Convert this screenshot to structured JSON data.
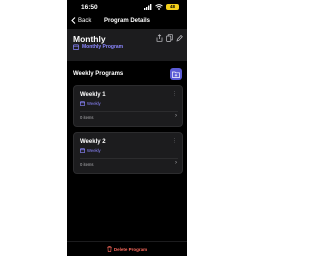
{
  "status_bar": {
    "time": "16:50",
    "battery": "48"
  },
  "nav": {
    "back_label": "Back",
    "title": "Program Details"
  },
  "program": {
    "title": "Monthly",
    "type": "Monthly Program"
  },
  "section": {
    "title": "Weekly Programs"
  },
  "cards": [
    {
      "title": "Weekly 1",
      "type": "Weekly",
      "count": "0 items"
    },
    {
      "title": "Weekly 2",
      "type": "Weekly",
      "count": "0 items"
    }
  ],
  "bottom": {
    "delete_label": "Delete Program"
  },
  "colors": {
    "accent": "#8b86ff",
    "add_button": "#5b5bd6",
    "danger": "#ff6b5e",
    "battery": "#f4d01a"
  },
  "icons": [
    "chevron-left-icon",
    "share-icon",
    "copy-icon",
    "pencil-icon",
    "calendar-icon",
    "folder-plus-icon",
    "more-icon",
    "chevron-right-icon",
    "trash-icon",
    "signal-icon",
    "wifi-icon",
    "battery-icon"
  ]
}
